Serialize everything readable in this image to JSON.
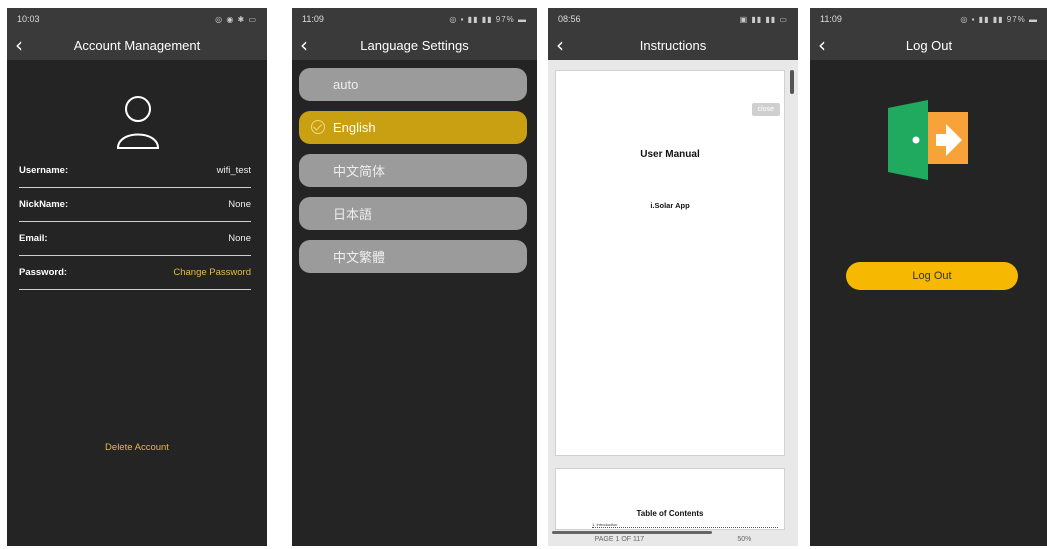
{
  "account": {
    "status_time": "10:03",
    "title": "Account Management",
    "rows": [
      {
        "label": "Username:",
        "value": "wifi_test"
      },
      {
        "label": "NickName:",
        "value": "None"
      },
      {
        "label": "Email:",
        "value": "None"
      },
      {
        "label": "Password:",
        "value": "Change Password"
      }
    ],
    "delete_label": "Delete Account"
  },
  "language": {
    "status_time": "11:09",
    "status_battery": "97%",
    "title": "Language Settings",
    "options": [
      {
        "label": "auto",
        "selected": false
      },
      {
        "label": "English",
        "selected": true
      },
      {
        "label": "中文简体",
        "selected": false
      },
      {
        "label": "日本語",
        "selected": false
      },
      {
        "label": "中文繁體",
        "selected": false
      }
    ]
  },
  "instructions": {
    "status_time": "08:56",
    "title": "Instructions",
    "close_label": "close",
    "page1_title": "User Manual",
    "page1_subtitle": "i.Solar App",
    "page2_title": "Table of Contents",
    "page2_entry": "1.   Introduction",
    "page_indicator": "PAGE 1 OF 117",
    "zoom": "50%"
  },
  "logout": {
    "status_time": "11:09",
    "status_battery": "97%",
    "title": "Log Out",
    "button_label": "Log Out"
  },
  "colors": {
    "background": "#242424",
    "bar": "#3a3a3a",
    "accent_gold": "#e5b94a",
    "selected_language": "#c9a012",
    "option_gray": "#9b9b9b",
    "logout_button": "#f6b800",
    "door_green": "#1faa5f",
    "door_orange": "#f7a33a"
  }
}
